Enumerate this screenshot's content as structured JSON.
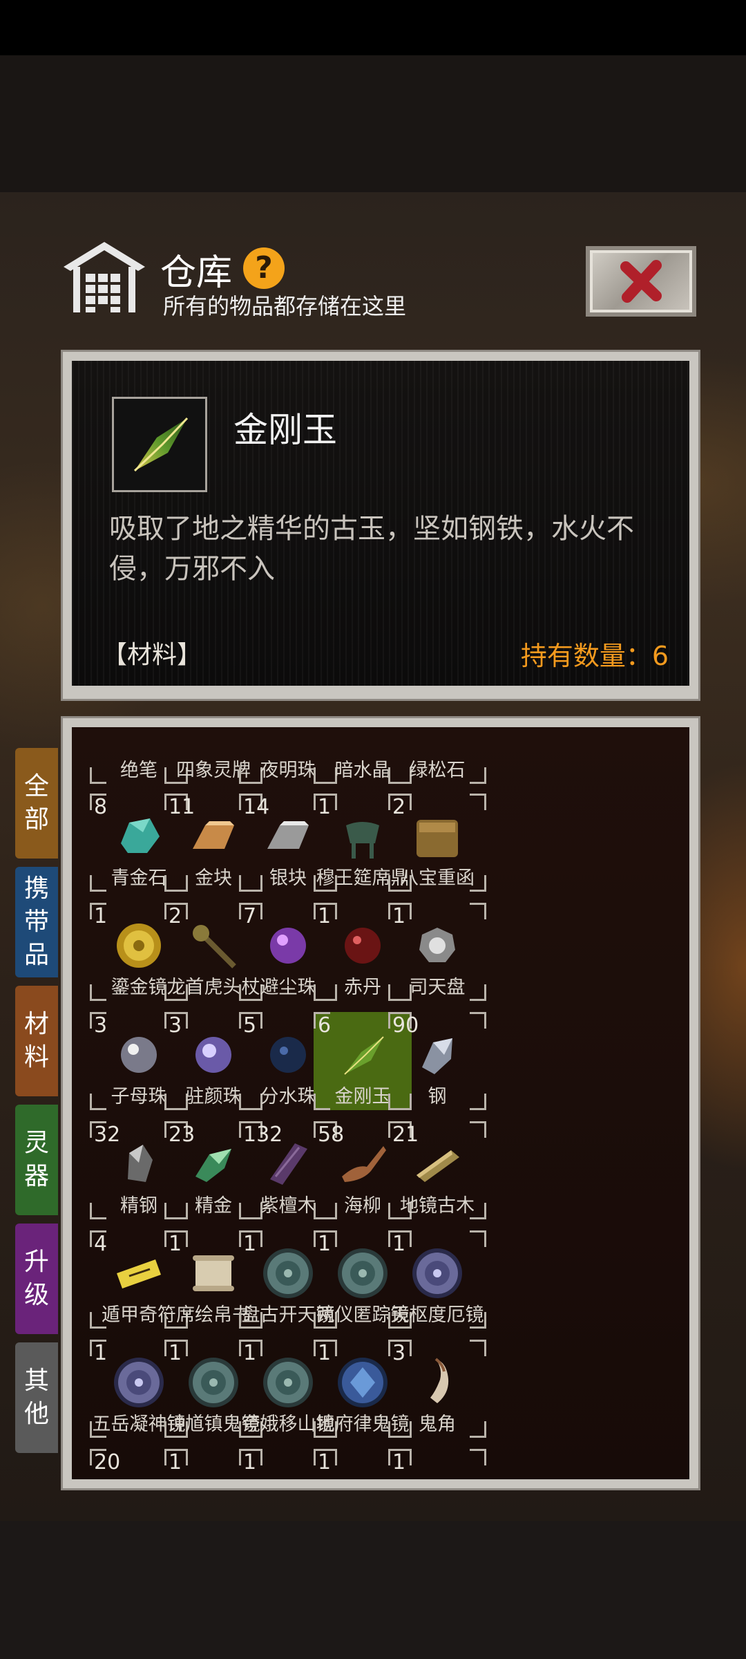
{
  "header": {
    "title": "仓库",
    "help": "?",
    "subtitle": "所有的物品都存储在这里"
  },
  "detail": {
    "name": "金刚玉",
    "description": "吸取了地之精华的古玉，坚如钢铁，水火不侵，万邪不入",
    "category": "【材料】",
    "count_label": "持有数量：6"
  },
  "tabs": [
    {
      "label": "全部",
      "color": "#8a5a1c"
    },
    {
      "label": "携带品",
      "color": "#1e4a78"
    },
    {
      "label": "材料",
      "color": "#8a4a1e"
    },
    {
      "label": "灵器",
      "color": "#2f6a2a"
    },
    {
      "label": "升级",
      "color": "#6a237a"
    },
    {
      "label": "其他",
      "color": "#5a5a5a"
    }
  ],
  "grid": {
    "selected": "金刚玉",
    "rows": [
      [
        {
          "name": "绝笔",
          "count": "",
          "icon": "brush-icon"
        },
        {
          "name": "四象灵牌",
          "count": "",
          "icon": "tablet-icon"
        },
        {
          "name": "夜明珠",
          "count": "",
          "icon": "pearl-icon"
        },
        {
          "name": "暗水晶",
          "count": "",
          "icon": "crystal-icon"
        },
        {
          "name": "绿松石",
          "count": "",
          "icon": "turquoise-icon"
        }
      ],
      [
        {
          "name": "青金石",
          "count": "8",
          "icon": "lapis-icon"
        },
        {
          "name": "金块",
          "count": "11",
          "icon": "gold-bar-icon"
        },
        {
          "name": "银块",
          "count": "14",
          "icon": "silver-bar-icon"
        },
        {
          "name": "穆王筵席鼎",
          "count": "1",
          "icon": "cauldron-icon"
        },
        {
          "name": "八宝重函",
          "count": "2",
          "icon": "chest-icon"
        }
      ],
      [
        {
          "name": "鎏金镜",
          "count": "1",
          "icon": "gold-mirror-icon"
        },
        {
          "name": "龙首虎头杖",
          "count": "2",
          "icon": "staff-icon"
        },
        {
          "name": "避尘珠",
          "count": "7",
          "icon": "purple-orb-icon"
        },
        {
          "name": "赤丹",
          "count": "1",
          "icon": "red-pill-icon"
        },
        {
          "name": "司天盘",
          "count": "1",
          "icon": "bagua-icon"
        }
      ],
      [
        {
          "name": "子母珠",
          "count": "3",
          "icon": "silver-orb-icon"
        },
        {
          "name": "驻颜珠",
          "count": "3",
          "icon": "lilac-orb-icon"
        },
        {
          "name": "分水珠",
          "count": "5",
          "icon": "dark-orb-icon"
        },
        {
          "name": "金刚玉",
          "count": "6",
          "icon": "jade-icon"
        },
        {
          "name": "钢",
          "count": "90",
          "icon": "steel-icon"
        }
      ],
      [
        {
          "name": "精钢",
          "count": "32",
          "icon": "fine-steel-icon"
        },
        {
          "name": "精金",
          "count": "23",
          "icon": "fine-gold-icon"
        },
        {
          "name": "紫檀木",
          "count": "132",
          "icon": "sandalwood-icon"
        },
        {
          "name": "海柳",
          "count": "58",
          "icon": "driftwood-icon"
        },
        {
          "name": "地镜古木",
          "count": "21",
          "icon": "old-wood-icon"
        }
      ],
      [
        {
          "name": "遁甲奇符",
          "count": "4",
          "icon": "talisman-icon"
        },
        {
          "name": "席绘帛书",
          "count": "1",
          "icon": "scroll-icon"
        },
        {
          "name": "盘古开天镜",
          "count": "1",
          "icon": "bronze-mirror-icon"
        },
        {
          "name": "两仪匿踪镜",
          "count": "1",
          "icon": "bronze-mirror-icon"
        },
        {
          "name": "天枢度厄镜",
          "count": "1",
          "icon": "violet-mirror-icon"
        }
      ],
      [
        {
          "name": "五岳凝神镜",
          "count": "1",
          "icon": "violet-mirror-icon"
        },
        {
          "name": "钟馗镇鬼镜",
          "count": "1",
          "icon": "bronze-mirror-icon"
        },
        {
          "name": "夸娥移山镜",
          "count": "1",
          "icon": "bronze-mirror-icon"
        },
        {
          "name": "地府律鬼镜",
          "count": "1",
          "icon": "blue-mirror-icon"
        },
        {
          "name": "鬼角",
          "count": "3",
          "icon": "horn-icon"
        }
      ],
      [
        {
          "name": "",
          "count": "20",
          "icon": ""
        },
        {
          "name": "",
          "count": "1",
          "icon": ""
        },
        {
          "name": "",
          "count": "1",
          "icon": ""
        },
        {
          "name": "",
          "count": "1",
          "icon": ""
        },
        {
          "name": "",
          "count": "1",
          "icon": ""
        }
      ]
    ]
  }
}
